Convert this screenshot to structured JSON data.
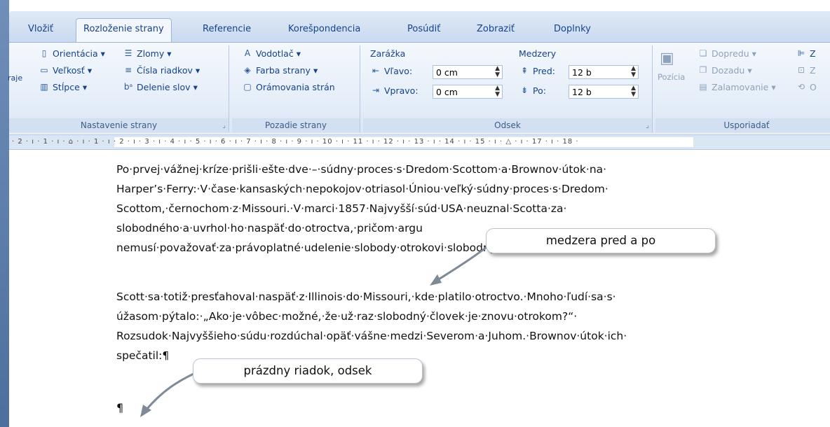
{
  "tabs": [
    "Vložiť",
    "Rozloženie strany",
    "Referencie",
    "Korešpondencia",
    "Posúdiť",
    "Zobraziť",
    "Doplnky"
  ],
  "active_tab": "Rozloženie strany",
  "ribbon": {
    "page_setup": {
      "label": "Nastavenie strany",
      "edge_label": "raje",
      "orientation": "Orientácia",
      "size": "Veľkosť",
      "columns": "Stĺpce",
      "breaks": "Zlomy",
      "line_numbers": "Čísla riadkov",
      "hyphenation": "Delenie slov"
    },
    "page_background": {
      "label": "Pozadie strany",
      "watermark": "Vodotlač",
      "page_color": "Farba strany",
      "page_borders": "Orámovania strán"
    },
    "paragraph": {
      "label": "Odsek",
      "indent_header": "Zarážka",
      "left_label": "Vľavo:",
      "left_value": "0 cm",
      "right_label": "Vpravo:",
      "right_value": "0 cm",
      "spacing_header": "Medzery",
      "before_label": "Pred:",
      "before_value": "12 b",
      "after_label": "Po:",
      "after_value": "12 b"
    },
    "arrange": {
      "label": "Usporiadať",
      "position": "Pozícia",
      "bring_forward": "Dopredu",
      "send_backward": "Dozadu",
      "text_wrapping": "Zalamovanie",
      "align_partial": "Z",
      "group_partial": "Z",
      "rotate_partial": "O"
    }
  },
  "ruler_text": "· 2 · ı · 1 · ı ·  ⌂ · ı · 1 · ı · 2 · ı · 3 · ı · 4 · ı · 5 · ı · 6 · ı · 7 · ı · 8 · ı · 9 · ı · 10 · ı · 11 · ı · 12 · ı · 13 · ı · 14 · ı · 15 · ı · △ · ı · 17 · ı · 18 ·",
  "document": {
    "para1_lines": [
      "Po·prvej·vážnej·kríze·prišli·ešte·dve·–·súdny·proces·s·Dredom·Scottom·a·Brownov·útok·na·",
      "Harper’s·Ferry:·V·čase·kansaských·nepokojov·otriasol·Úniou·veľký·súdny·proces·s·Dredom·",
      "Scottom,·černochom·z·Missouri.·V·marci·1857·Najvyšší·súd·USA·neuznal·Scotta·za·",
      "slobodného·a·uvrhol·ho·naspäť·do·otroctva,·pričom·argu",
      "nemusí·považovať·za·právoplatné·udelenie·slobody·otrokovi·slobodným·štátom.·¶"
    ],
    "para2_lines": [
      "Scott·sa·totiž·presťahoval·naspäť·z·Illinois·do·Missouri,·kde·platilo·otroctvo.·Mnoho·ľudí·sa·s·",
      "úžasom·pýtalo:·„Ako·je·vôbec·možné,·že·už·raz·slobodný·človek·je·znovu·otrokom?“·",
      "Rozsudok·Najvyššieho·súdu·rozdúchal·opäť·vášne·medzi·Severom·a·Juhom.·Brownov·útok·ich·",
      "spečatil:¶"
    ],
    "empty_para_mark": "¶"
  },
  "callouts": {
    "spacing": "medzera pred a po",
    "empty_line": "prázdny riadok, odsek"
  }
}
